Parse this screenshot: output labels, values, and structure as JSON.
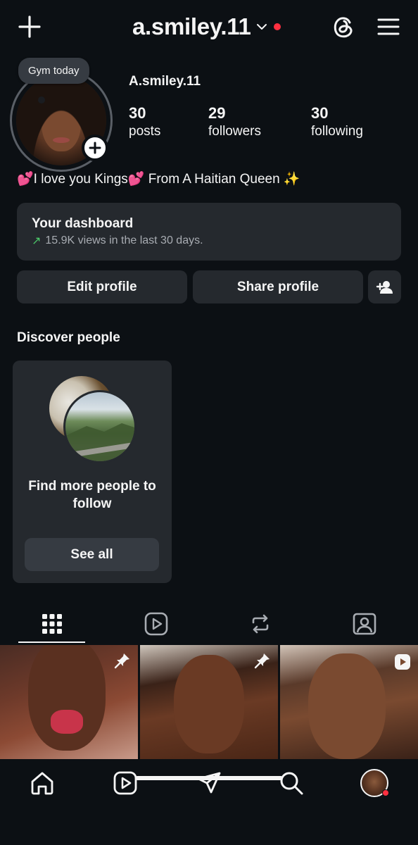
{
  "header": {
    "username": "a.smiley.11",
    "has_notification": true,
    "icons": [
      "plus-icon",
      "chevron-down-icon",
      "threads-icon",
      "menu-icon"
    ]
  },
  "profile": {
    "note": "Gym today",
    "display_name": "A.smiley.11",
    "stats": [
      {
        "value": "30",
        "label": "posts"
      },
      {
        "value": "29",
        "label": "followers"
      },
      {
        "value": "30",
        "label": "following"
      }
    ],
    "bio": "💕I love you Kings💕 From A Haitian Queen ✨"
  },
  "dashboard": {
    "title": "Your dashboard",
    "arrow": "↗",
    "subtitle": "15.9K views in the last 30 days."
  },
  "actions": {
    "edit_label": "Edit profile",
    "share_label": "Share profile"
  },
  "discover": {
    "title": "Discover people",
    "card_text": "Find more people to follow",
    "see_all": "See all"
  },
  "tabs": [
    "grid-icon",
    "reels-icon",
    "reposts-icon",
    "tagged-icon"
  ],
  "posts": [
    {
      "pinned": true,
      "type": "photo"
    },
    {
      "pinned": true,
      "type": "photo"
    },
    {
      "pinned": false,
      "type": "reel"
    }
  ],
  "bottom_nav": [
    "home-icon",
    "reels-icon",
    "direct-message-icon",
    "search-icon",
    "profile-avatar"
  ],
  "colors": {
    "background": "#0c1014",
    "surface": "#25292e",
    "notification": "#ff3040",
    "trend_up": "#4ccb6a"
  }
}
